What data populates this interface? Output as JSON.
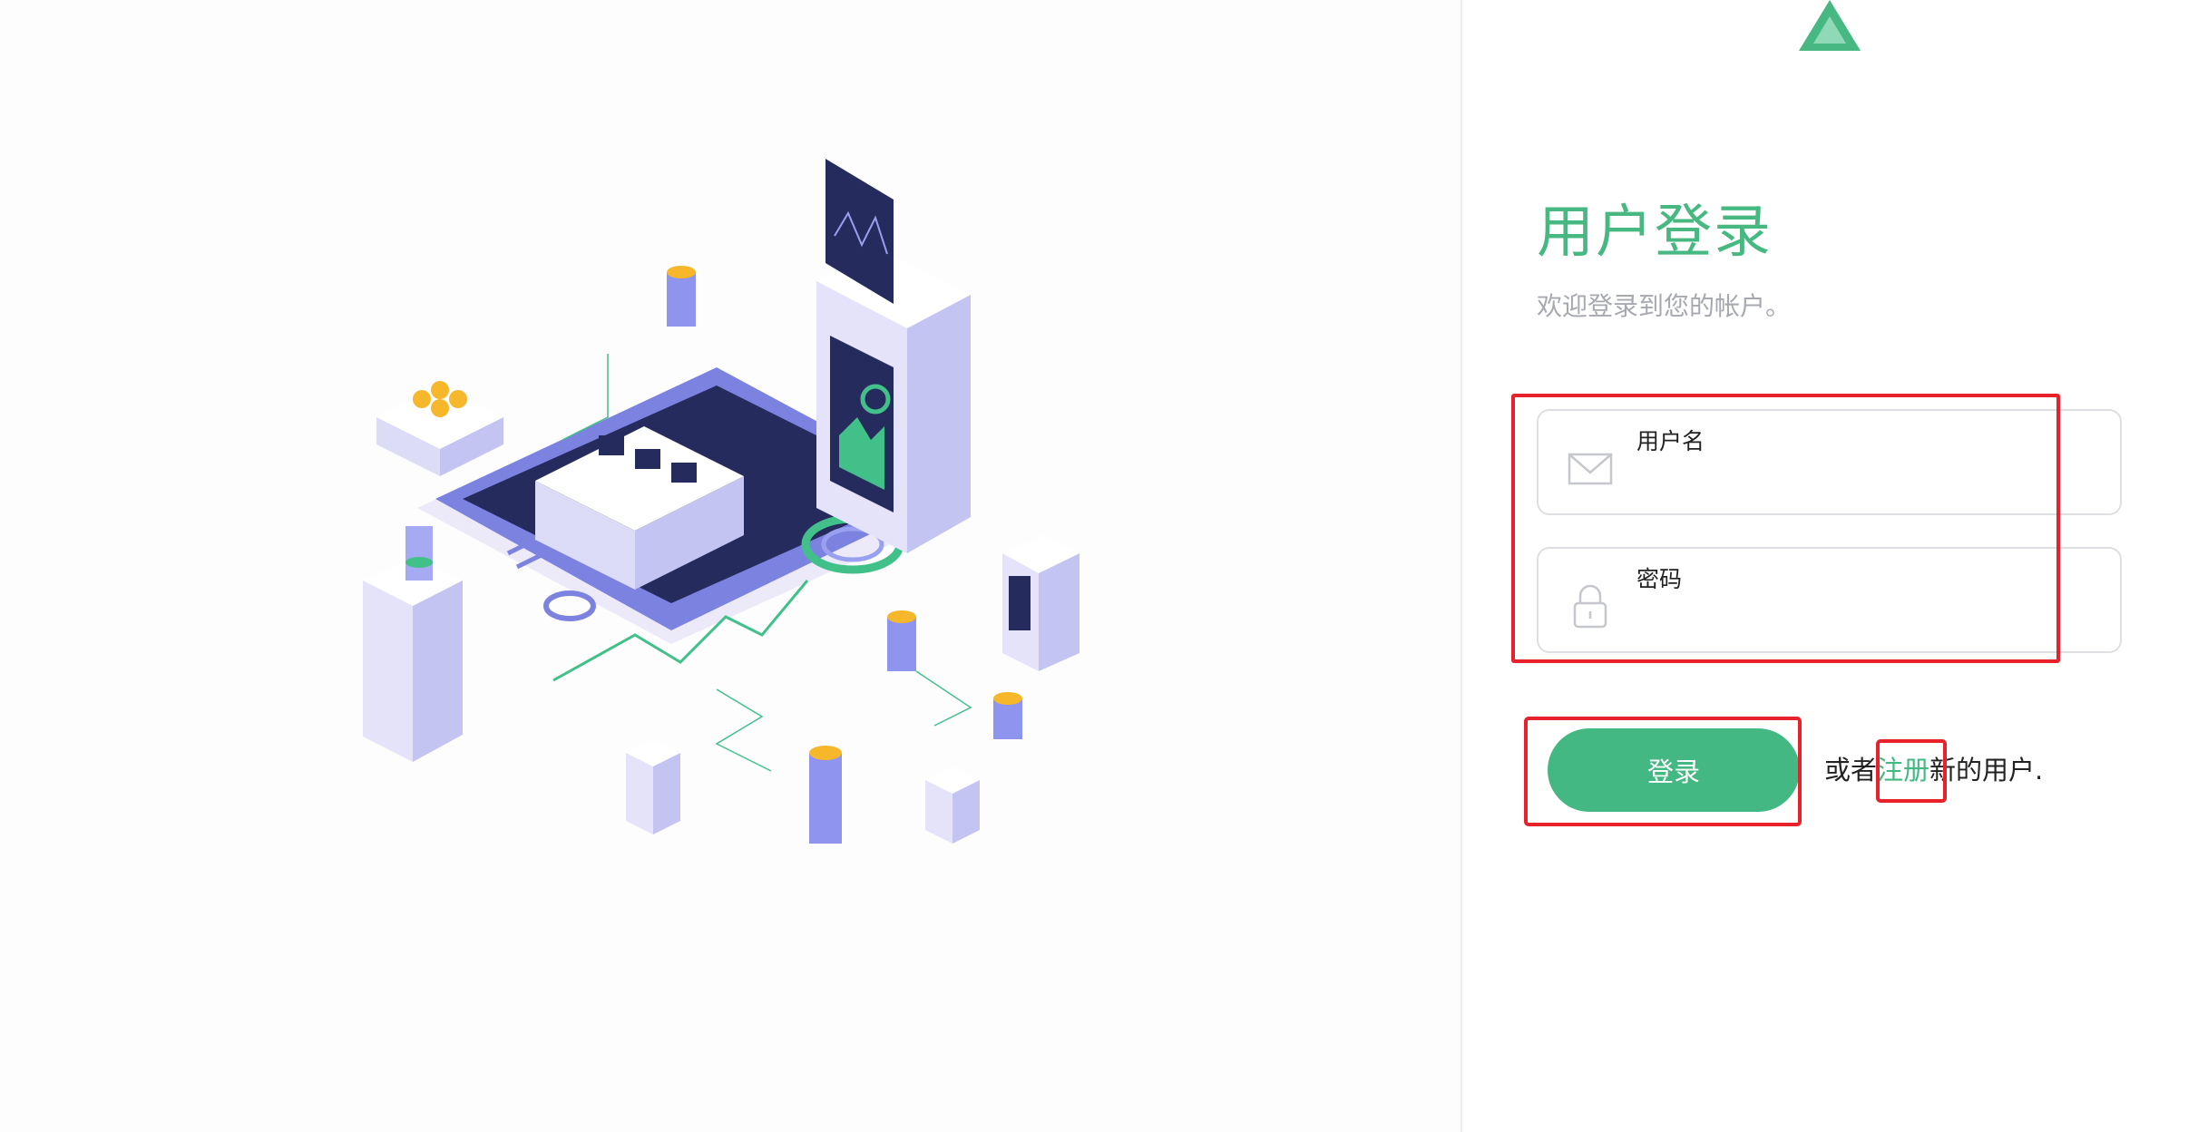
{
  "login": {
    "title": "用户登录",
    "subtitle": "欢迎登录到您的帐户。",
    "username": {
      "label": "用户名",
      "value": "",
      "icon": "envelope-icon"
    },
    "password": {
      "label": "密码",
      "value": "",
      "icon": "lock-icon"
    },
    "login_button": "登录",
    "register_prefix": "或者",
    "register_link": "注册",
    "register_suffix": "新的用户."
  },
  "colors": {
    "accent": "#43b883",
    "illustration_navy": "#262b5e",
    "illustration_lavender": "#dcdcf7",
    "annotation_red": "#e8222a"
  },
  "icons": {
    "logo": "triangle-logo-icon",
    "illustration": "isometric-crypto-platform-illustration"
  }
}
